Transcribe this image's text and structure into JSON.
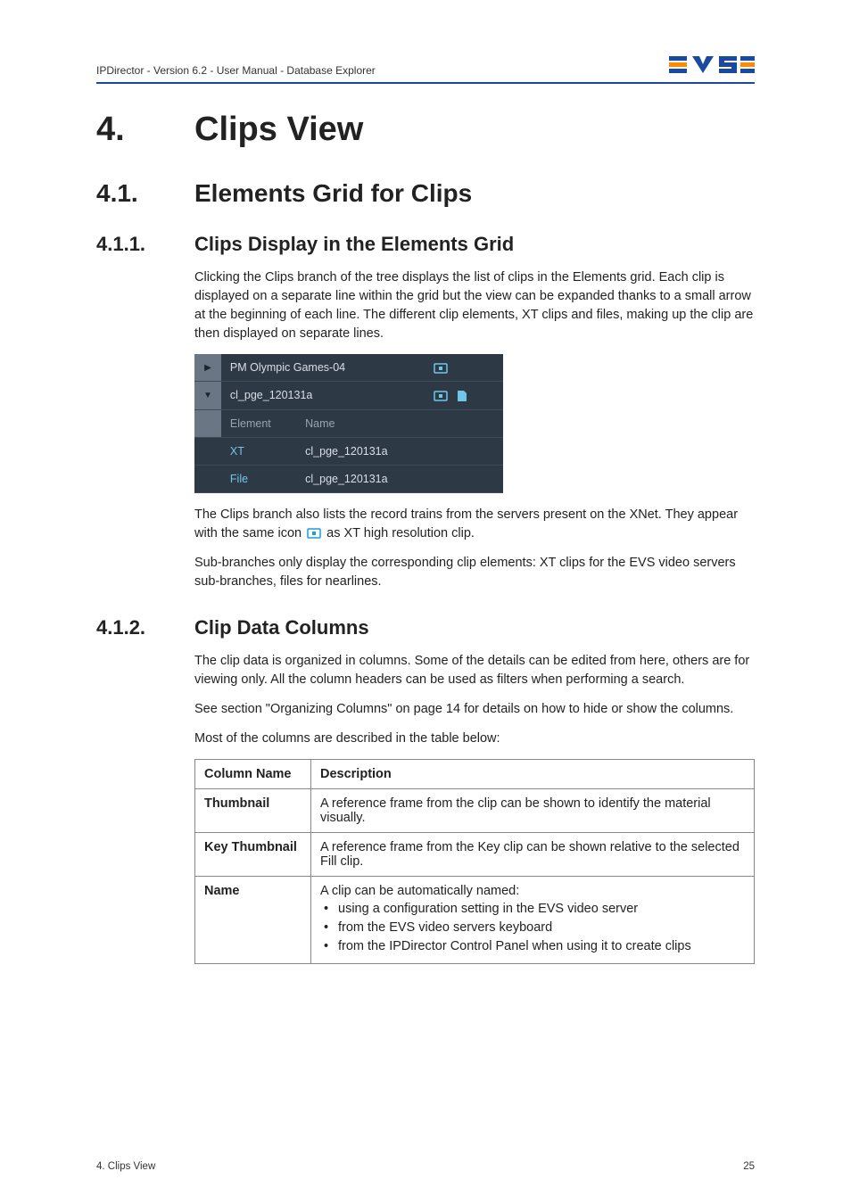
{
  "header": {
    "breadcrumb": "IPDirector - Version 6.2 - User Manual - Database Explorer"
  },
  "h1": {
    "num": "4.",
    "text": "Clips View"
  },
  "h2_1": {
    "num": "4.1.",
    "text": "Elements Grid for Clips"
  },
  "h3_1": {
    "num": "4.1.1.",
    "text": "Clips Display in the Elements Grid"
  },
  "p1": "Clicking the Clips branch of the tree displays the list of clips in the Elements grid. Each clip is displayed on a separate line within the grid but the view can be expanded thanks to a small arrow at the beginning of each line. The different clip elements, XT clips and files, making up the clip are then displayed on separate lines.",
  "grid": {
    "row1": "PM Olympic Games-04",
    "row2": "cl_pge_120131a",
    "hdr_element": "Element",
    "hdr_name": "Name",
    "r3_el": "XT",
    "r3_name": "cl_pge_120131a",
    "r4_el": "File",
    "r4_name": "cl_pge_120131a"
  },
  "p2a": "The Clips branch also lists the record trains from the servers present on the XNet. They appear with the same icon ",
  "p2b": " as XT high resolution clip.",
  "p3": "Sub-branches only display the corresponding clip elements: XT clips for the EVS video servers sub-branches, files for nearlines.",
  "h3_2": {
    "num": "4.1.2.",
    "text": "Clip Data Columns"
  },
  "p4": "The clip data is organized in columns. Some of the details can be edited from here, others are for viewing only. All the column headers can be used as filters when performing a search.",
  "p5": "See section \"Organizing Columns\" on page 14 for details on how to hide or show the columns.",
  "p6": "Most of the columns are described in the table below:",
  "table": {
    "hdr_col": "Column Name",
    "hdr_desc": "Description",
    "rows": [
      {
        "name": "Thumbnail",
        "desc": "A reference frame from the clip can be shown to identify the material visually."
      },
      {
        "name": "Key Thumbnail",
        "desc": "A reference frame from the Key clip can be shown relative to the selected Fill clip."
      },
      {
        "name": "Name",
        "desc_lead": "A clip can be automatically named:",
        "bullets": [
          "using a configuration setting in the EVS video server",
          "from the EVS video servers keyboard",
          "from the IPDirector Control Panel when using it to create clips"
        ]
      }
    ]
  },
  "footer": {
    "left": "4. Clips View",
    "right": "25"
  }
}
